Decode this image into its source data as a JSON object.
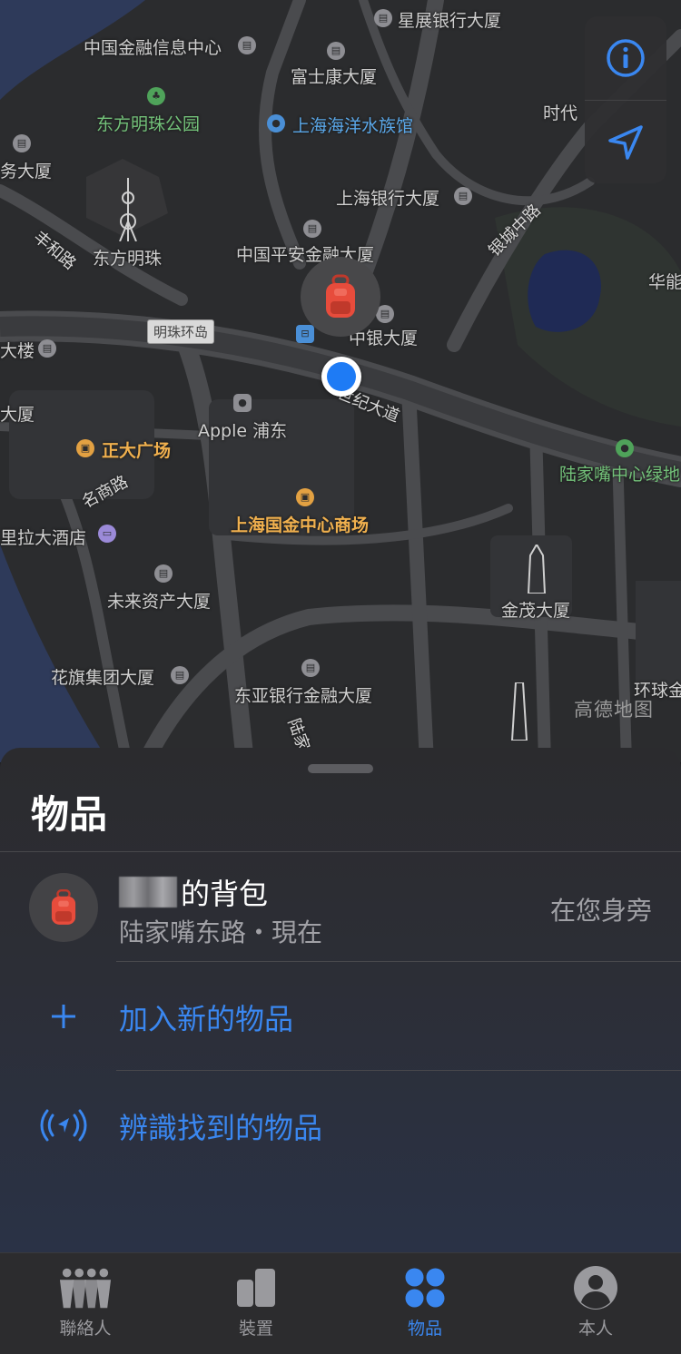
{
  "map": {
    "labels": {
      "xingzhan": "星展银行大厦",
      "zhongguo_jinrong": "中国金融信息中心",
      "fushikang": "富士康大厦",
      "dongfang_park": "东方明珠公园",
      "aquarium": "上海海洋水族馆",
      "shidai": "时代",
      "wudasha": "务大厦",
      "shanghai_bank": "上海银行大厦",
      "fenghe_road": "丰和路",
      "dongfang_mingzhu": "东方明珠",
      "pingan": "中国平安金融大厦",
      "yincheng_road": "银城中路",
      "huaneng": "华能",
      "mingzhu_station": "明珠环岛",
      "zhongyin": "中银大厦",
      "dalou": "大楼",
      "century_ave": "世纪大道",
      "dasha_left": "大厦",
      "apple": "Apple 浦东",
      "zhengda": "正大广场",
      "ljz_green": "陆家嘴中心绿地",
      "mingshang_road": "名商路",
      "ifc": "上海国金中心商场",
      "shangri_la": "里拉大酒店",
      "future_asset": "未来资产大厦",
      "jinmao": "金茂大厦",
      "citi": "花旗集团大厦",
      "bea": "东亚银行金融大厦",
      "huanqiu": "环球金",
      "lujia_road": "陆家",
      "watermark": "高德地图"
    }
  },
  "sheet": {
    "title": "物品",
    "item": {
      "name_suffix": "的背包",
      "location": "陆家嘴东路・現在",
      "status": "在您身旁"
    },
    "actions": {
      "add": "加入新的物品",
      "identify": "辨識找到的物品"
    }
  },
  "tabs": {
    "people": "聯絡人",
    "devices": "裝置",
    "items": "物品",
    "me": "本人"
  },
  "colors": {
    "accent": "#3a87f0",
    "user_dot": "#1e7bf5",
    "background": "#1c1c1e"
  }
}
